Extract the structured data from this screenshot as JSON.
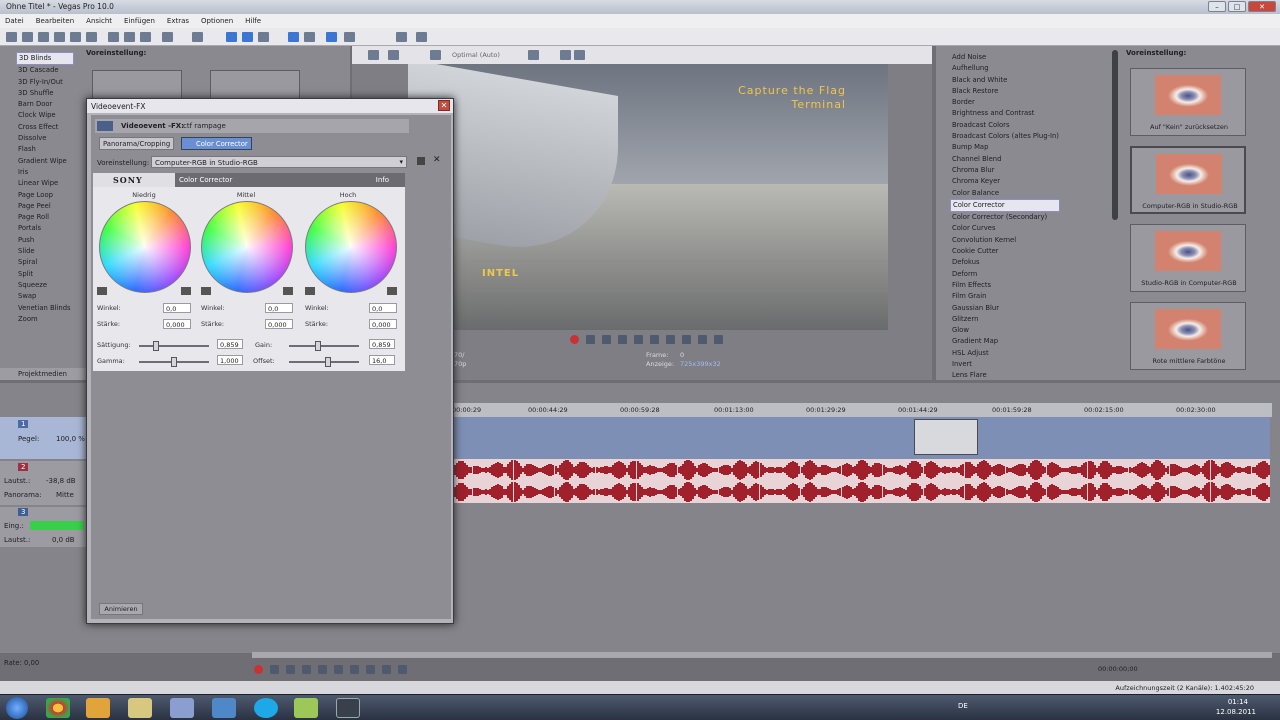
{
  "window": {
    "title": "Ohne Titel * - Vegas Pro 10.0"
  },
  "menu": [
    "Datei",
    "Bearbeiten",
    "Ansicht",
    "Einfügen",
    "Extras",
    "Optionen",
    "Hilfe"
  ],
  "transitions": {
    "items": [
      "3D Blinds",
      "3D Cascade",
      "3D Fly-In/Out",
      "3D Shuffle",
      "Barn Door",
      "Clock Wipe",
      "Cross Effect",
      "Dissolve",
      "Flash",
      "Gradient Wipe",
      "Iris",
      "Linear Wipe",
      "Page Loop",
      "Page Peel",
      "Page Roll",
      "Portals",
      "Push",
      "Slide",
      "Spiral",
      "Split",
      "Squeeze",
      "Swap",
      "Venetian Blinds",
      "Zoom"
    ],
    "selected": "3D Blinds",
    "preset_header": "Voreinstellung:"
  },
  "tabs": {
    "project_media": "Projektmedien"
  },
  "fx_window": {
    "title": "Videoevent-FX",
    "event_label": "Videoevent -FX:",
    "event_name": "ctf rampage",
    "chain": [
      "Panorama/Cropping",
      "Color Corrector"
    ],
    "preset_label": "Voreinstellung:",
    "preset_value": "Computer-RGB in Studio-RGB",
    "brand": "SONY",
    "plugin": "Color Corrector",
    "info": "Info",
    "wheels": [
      "Niedrig",
      "Mittel",
      "Hoch"
    ],
    "wheel_letters": {
      "Mg": "Mg",
      "R": "R",
      "Yl": "Yl",
      "G": "G",
      "Cy": "Cy",
      "B": "B"
    },
    "winkel_label": "Winkel:",
    "staerke_label": "Stärke:",
    "winkel_values": [
      "0,0",
      "0,0",
      "0,0"
    ],
    "staerke_values": [
      "0,000",
      "0,000",
      "0,000"
    ],
    "saettigung_label": "Sättigung:",
    "saettigung_value": "0,859",
    "gain_label": "Gain:",
    "gain_value": "0,859",
    "gamma_label": "Gamma:",
    "gamma_value": "1,000",
    "offset_label": "Offset:",
    "offset_value": "16,0",
    "animate_button": "Animieren"
  },
  "preview": {
    "quality": "Optimal (Auto)",
    "game_title": "Capture the Flag",
    "game_subtitle": "Terminal",
    "intel": "INTEL",
    "frame_label": "Frame:",
    "frame_value": "0",
    "display_label": "Anzeige:",
    "display_value": "725x399x32",
    "left_info_1": "70/",
    "left_info_2": "70p"
  },
  "fx_list": {
    "items": [
      "Add Noise",
      "Aufhellung",
      "Black and White",
      "Black Restore",
      "Border",
      "Brightness and Contrast",
      "Broadcast Colors",
      "Broadcast Colors (altes Plug-In)",
      "Bump Map",
      "Channel Blend",
      "Chroma Blur",
      "Chroma Keyer",
      "Color Balance",
      "Color Corrector",
      "Color Corrector (Secondary)",
      "Color Curves",
      "Convolution Kernel",
      "Cookie Cutter",
      "Defokus",
      "Deform",
      "Film Effects",
      "Film Grain",
      "Gaussian Blur",
      "Glitzern",
      "Glow",
      "Gradient Map",
      "HSL Adjust",
      "Invert",
      "Lens Flare"
    ],
    "selected": "Color Corrector",
    "preset_header": "Voreinstellung:",
    "presets": [
      "Auf \"Kein\" zurücksetzen",
      "Computer-RGB in Studio-RGB",
      "Studio-RGB in Computer-RGB",
      "Rote mittlere Farbtöne"
    ]
  },
  "timeline": {
    "ticks": [
      "00:00:29",
      "00:00:44:29",
      "00:00:59:28",
      "00:01:13:00",
      "00:01:29:29",
      "00:01:44:29",
      "00:01:59:28",
      "00:02:15:00",
      "00:02:30:00"
    ],
    "track1": {
      "num": "1",
      "level_label": "Pegel:",
      "level_value": "100,0 %"
    },
    "track2": {
      "num": "2",
      "vol_label": "Lautst.:",
      "vol_value": "-38,8 dB",
      "pan_label": "Panorama:",
      "pan_value": "Mitte"
    },
    "track3": {
      "num": "3",
      "in_label": "Eing.:",
      "vol_label": "Lautst.:",
      "vol_value": "0,0 dB"
    },
    "rate": "Rate: 0,00"
  },
  "status": {
    "record_time": "Aufzeichnungszeit (2 Kanäle): 1.402:45:20",
    "cursor_time": "00:00:00;00"
  },
  "taskbar": {
    "lang": "DE",
    "time": "01:14",
    "date": "12.08.2011"
  }
}
